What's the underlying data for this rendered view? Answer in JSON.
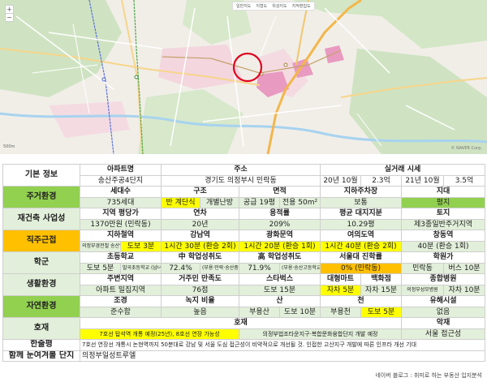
{
  "map": {
    "toolbar": [
      "일반지도",
      "지형도",
      "위성지도",
      "지적편집도"
    ],
    "scale": "500m",
    "copyright": "© NAVER Corp."
  },
  "colors": {
    "header_green": "#92d050",
    "highlight_yellow": "#ffff00",
    "pale_green": "#e2efda",
    "orange": "#ffc000",
    "marker_red": "#e0001b"
  },
  "table": {
    "basic": {
      "cat": "기본 정보",
      "h_apt": "아파트명",
      "h_addr": "주소",
      "h_deal": "실거래 시세",
      "apt": "송산주공4단지",
      "addr": "경기도 의정부시 민락동",
      "deal1_date": "20년 10월",
      "deal1_price": "2.3억",
      "deal2_date": "21년 10월",
      "deal2_price": "3.5억"
    },
    "living": {
      "cat": "주거환경",
      "h1": "세대수",
      "h2": "구조",
      "h3": "면적",
      "h4": "지하주차장",
      "h5": "지대",
      "v1": "735세대",
      "v2a": "반 계단식",
      "v2b": "개별난방",
      "v3a": "공급 19평",
      "v3b": "전용 50m²",
      "v4": "보통",
      "v5": "평지"
    },
    "rebuild": {
      "cat": "재건축 사업성",
      "h1": "지역 평당가",
      "h2": "연차",
      "h3": "용적률",
      "h4": "평균 대지지분",
      "h5": "토지",
      "v1": "1370만원 (민락동)",
      "v2": "20년",
      "v3": "209%",
      "v4": "10.29평",
      "v5": "제3종일반주거지역"
    },
    "commute": {
      "cat": "직주근접",
      "h1": "지하철역",
      "h2": "강남역",
      "h3": "광화문역",
      "h4": "여의도역",
      "h5": "창동역",
      "v1a": "의정부경전철 송산역",
      "v1b": "도보 3분",
      "v2": "1시간 30분 (환승 2회)",
      "v3": "1시간 20분 (환승 1회)",
      "v4": "1시간 40분 (환승 2회)",
      "v5": "40분 (환승 1회)"
    },
    "school": {
      "cat": "학군",
      "h1": "초등학교",
      "h2": "中 학업성취도",
      "h3": "高 학업성취도",
      "h4": "서울대 진학률",
      "h5": "학원가",
      "v1a": "도보 5분",
      "v1b": "발곡초등학교 (남녀공학)",
      "v2a": "72.4%",
      "v2b": "(부용·민락·송산중학교)",
      "v3a": "71.9%",
      "v3b": "(부용·송산고등학교)",
      "v4": "0% (민락동)",
      "v5a": "민락동",
      "v5b": "버스 10분"
    },
    "life": {
      "cat": "생활환경",
      "h1": "주변지역",
      "h2": "거주민 만족도",
      "h3": "스타벅스",
      "h4a": "대형마트",
      "h4b": "백화점",
      "h5": "종합병원",
      "v1": "아파트 밀집지역",
      "v2": "76점",
      "v3": "도보 15분",
      "v4a": "자차 5분",
      "v4b": "자차 15분",
      "v5a": "의정부성모병원",
      "v5b": "자차 10분"
    },
    "nature": {
      "cat": "자연환경",
      "h1": "조경",
      "h2": "녹지 비율",
      "h3": "산",
      "h4": "천",
      "h5": "유해시설",
      "v1": "준수함",
      "v2": "높음",
      "v3a": "부용산",
      "v3b": "도보 10분",
      "v4a": "부용천",
      "v4b": "도보 5분",
      "v5": "없음"
    },
    "plus": {
      "cat": "호재",
      "h_good": "호재",
      "h_bad": "악재",
      "good1": "7호선 탑석역 개통 예정(25년), 8호선 연장 가능성",
      "good2": "의정부법조타운지구·복합문화융합단지 개발 예정",
      "bad": "서울 접근성"
    },
    "review": {
      "cat": "한줄평",
      "text": "7호선 연장선 개통시 논현역까지 50분대로 강남 및 서울 도심 접근성이 비약적으로 개선될 것. 인접한 고산지구 개발에 따른 인프라 개선 기대"
    },
    "together": {
      "cat": "함께 눈여겨볼 단지",
      "text": "의정부일성트루엘"
    }
  },
  "credit": "네이버 블로그 : 취미로 하는 부동산 입지분석"
}
